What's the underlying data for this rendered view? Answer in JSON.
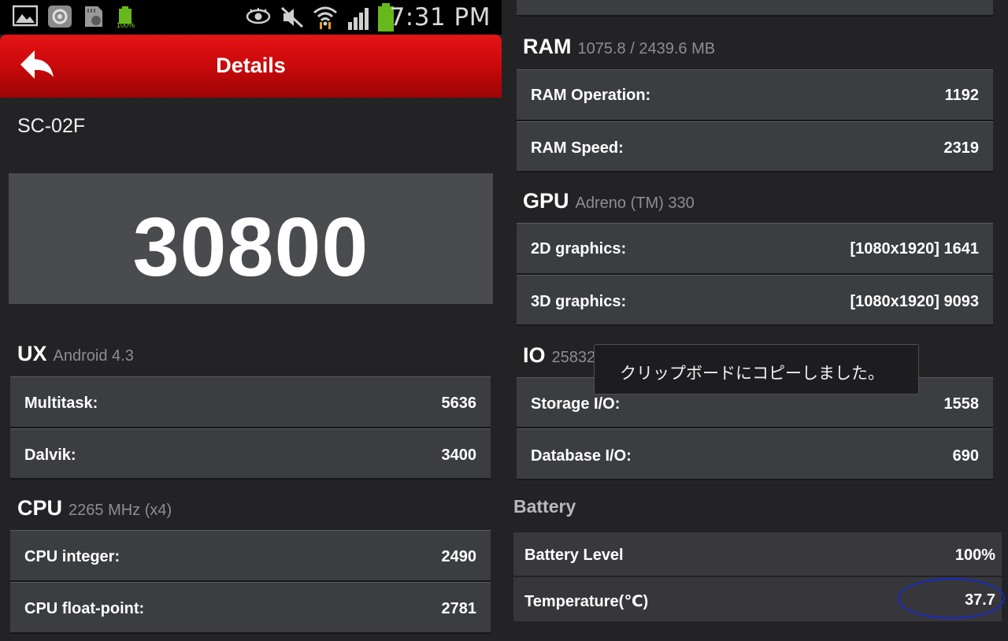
{
  "status_bar": {
    "time": "7:31 PM",
    "battery_small_pct": "100%",
    "icons": [
      "gallery-icon",
      "settings-icon",
      "sd-card-icon",
      "battery-small-icon",
      "eye-icon",
      "mute-icon",
      "wifi-icon",
      "signal-icon",
      "battery-icon"
    ]
  },
  "action_bar": {
    "title": "Details",
    "back_icon": "back-arrow-icon"
  },
  "device": {
    "model": "SC-02F"
  },
  "score": {
    "total": "30800"
  },
  "ux": {
    "title": "UX",
    "subtitle": "Android 4.3",
    "rows": [
      {
        "label": "Multitask:",
        "value": "5636"
      },
      {
        "label": "Dalvik:",
        "value": "3400"
      }
    ]
  },
  "cpu": {
    "title": "CPU",
    "subtitle": "2265 MHz (x4)",
    "rows": [
      {
        "label": "CPU integer:",
        "value": "2490"
      },
      {
        "label": "CPU float-point:",
        "value": "2781"
      }
    ]
  },
  "ram": {
    "title": "RAM",
    "subtitle": "1075.8 / 2439.6 MB",
    "rows": [
      {
        "label": "RAM Operation:",
        "value": "1192"
      },
      {
        "label": "RAM Speed:",
        "value": "2319"
      }
    ]
  },
  "gpu": {
    "title": "GPU",
    "subtitle": "Adreno (TM) 330",
    "rows": [
      {
        "label": "2D graphics:",
        "value": "[1080x1920] 1641"
      },
      {
        "label": "3D graphics:",
        "value": "[1080x1920] 9093"
      }
    ]
  },
  "io": {
    "title": "IO",
    "subtitle": "25832",
    "rows": [
      {
        "label": "Storage I/O:",
        "value": "1558"
      },
      {
        "label": "Database I/O:",
        "value": "690"
      }
    ]
  },
  "battery": {
    "title": "Battery",
    "rows": [
      {
        "label": "Battery Level",
        "value": "100%"
      },
      {
        "label": "Temperature(℃)",
        "value": "37.7"
      }
    ]
  },
  "toast": {
    "message": "クリップボードにコピーしました。"
  },
  "colors": {
    "action_bar_red": "#cc0a0c",
    "card_bg": "#3c3d41",
    "highlight_ellipse": "#1727c8"
  }
}
